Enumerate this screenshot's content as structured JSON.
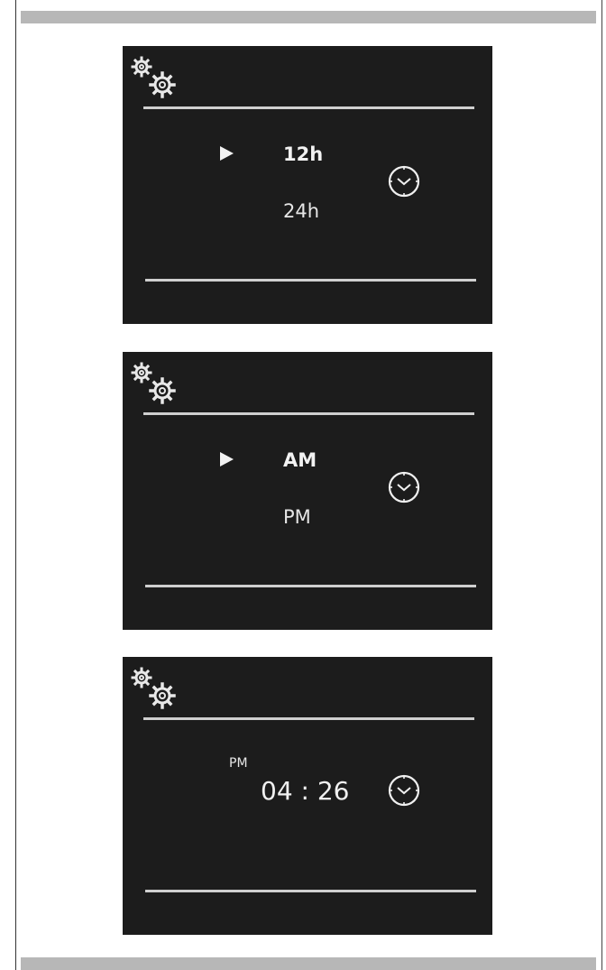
{
  "screens": [
    {
      "icon": "gear-settings-icon",
      "selected_option": "12h",
      "other_option": "24h",
      "clock_icon": "clock-icon"
    },
    {
      "icon": "gear-settings-icon",
      "selected_option": "AM",
      "other_option": "PM",
      "clock_icon": "clock-icon"
    },
    {
      "icon": "gear-settings-icon",
      "period": "PM",
      "time": "04 : 26",
      "clock_icon": "clock-icon"
    }
  ],
  "colors": {
    "screen_background": "#1c1c1c",
    "text": "#f2f2f2",
    "divider": "#cfcfcf",
    "page_bar": "#b7b7b7"
  }
}
